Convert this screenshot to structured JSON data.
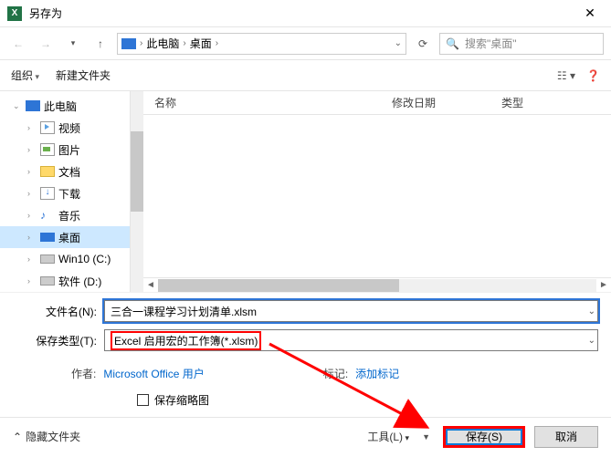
{
  "title": "另存为",
  "nav": {
    "this_pc": "此电脑",
    "desktop": "桌面",
    "search_placeholder": "搜索\"桌面\""
  },
  "toolbar": {
    "organize": "组织",
    "new_folder": "新建文件夹"
  },
  "tree": {
    "this_pc": "此电脑",
    "video": "视频",
    "pictures": "图片",
    "documents": "文档",
    "downloads": "下载",
    "music": "音乐",
    "desktop": "桌面",
    "win10": "Win10 (C:)",
    "soft": "软件 (D:)"
  },
  "columns": {
    "name": "名称",
    "modified": "修改日期",
    "type": "类型"
  },
  "form": {
    "filename_label": "文件名(N):",
    "filename_value": "三合一课程学习计划清单.xlsm",
    "savetype_label": "保存类型(T):",
    "savetype_value": "Excel 启用宏的工作簿(*.xlsm)",
    "author_label": "作者:",
    "author_value": "Microsoft Office 用户",
    "tags_label": "标记:",
    "tags_value": "添加标记",
    "thumb_label": "保存缩略图"
  },
  "footer": {
    "hide_folders": "隐藏文件夹",
    "tools": "工具(L)",
    "save": "保存(S)",
    "cancel": "取消"
  }
}
